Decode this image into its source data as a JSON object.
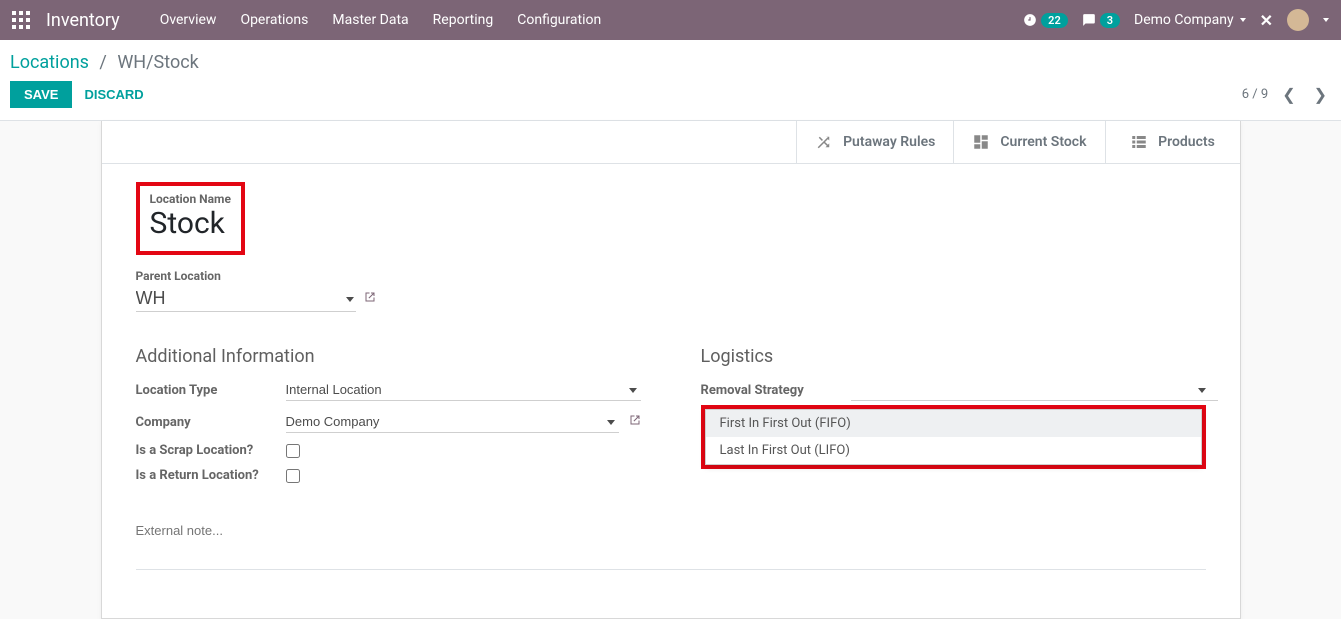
{
  "navbar": {
    "brand": "Inventory",
    "menu": [
      "Overview",
      "Operations",
      "Master Data",
      "Reporting",
      "Configuration"
    ],
    "badge_activities": "22",
    "badge_messages": "3",
    "company": "Demo Company"
  },
  "breadcrumb": {
    "parent": "Locations",
    "current": "WH/Stock"
  },
  "actions": {
    "save": "SAVE",
    "discard": "DISCARD"
  },
  "pager": {
    "text": "6 / 9"
  },
  "stat_buttons": {
    "putaway": "Putaway Rules",
    "stock": "Current Stock",
    "products": "Products"
  },
  "form": {
    "location_name_label": "Location Name",
    "location_name": "Stock",
    "parent_label": "Parent Location",
    "parent_value": "WH",
    "section_additional": "Additional Information",
    "section_logistics": "Logistics",
    "location_type_label": "Location Type",
    "location_type_value": "Internal Location",
    "company_label": "Company",
    "company_value": "Demo Company",
    "scrap_label": "Is a Scrap Location?",
    "return_label": "Is a Return Location?",
    "removal_label": "Removal Strategy",
    "removal_options": [
      "First In First Out (FIFO)",
      "Last In First Out (LIFO)"
    ],
    "external_note_placeholder": "External note..."
  }
}
